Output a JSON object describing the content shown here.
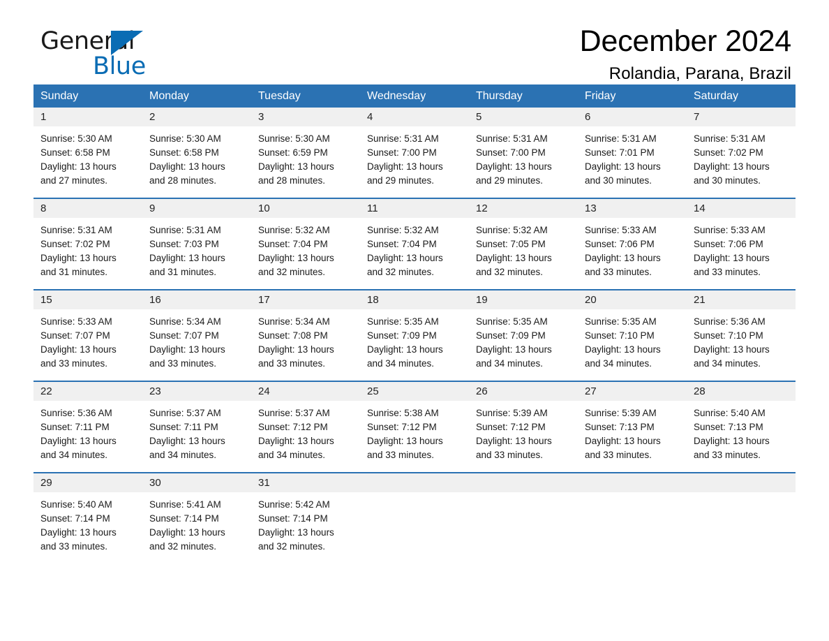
{
  "brand": {
    "name_part1": "General",
    "name_part2": "Blue",
    "logo_icon": "triangle-icon",
    "accent_color": "#0a6cb4"
  },
  "header": {
    "title": "December 2024",
    "subtitle": "Rolandia, Parana, Brazil"
  },
  "theme": {
    "header_blue": "#2b72b3",
    "daynum_band": "#f0f0f0",
    "text": "#1a1a1a"
  },
  "weekdays": [
    "Sunday",
    "Monday",
    "Tuesday",
    "Wednesday",
    "Thursday",
    "Friday",
    "Saturday"
  ],
  "weeks": [
    {
      "days": [
        {
          "date": "1",
          "lines": [
            "Sunrise: 5:30 AM",
            "Sunset: 6:58 PM",
            "Daylight: 13 hours",
            "and 27 minutes."
          ]
        },
        {
          "date": "2",
          "lines": [
            "Sunrise: 5:30 AM",
            "Sunset: 6:58 PM",
            "Daylight: 13 hours",
            "and 28 minutes."
          ]
        },
        {
          "date": "3",
          "lines": [
            "Sunrise: 5:30 AM",
            "Sunset: 6:59 PM",
            "Daylight: 13 hours",
            "and 28 minutes."
          ]
        },
        {
          "date": "4",
          "lines": [
            "Sunrise: 5:31 AM",
            "Sunset: 7:00 PM",
            "Daylight: 13 hours",
            "and 29 minutes."
          ]
        },
        {
          "date": "5",
          "lines": [
            "Sunrise: 5:31 AM",
            "Sunset: 7:00 PM",
            "Daylight: 13 hours",
            "and 29 minutes."
          ]
        },
        {
          "date": "6",
          "lines": [
            "Sunrise: 5:31 AM",
            "Sunset: 7:01 PM",
            "Daylight: 13 hours",
            "and 30 minutes."
          ]
        },
        {
          "date": "7",
          "lines": [
            "Sunrise: 5:31 AM",
            "Sunset: 7:02 PM",
            "Daylight: 13 hours",
            "and 30 minutes."
          ]
        }
      ]
    },
    {
      "days": [
        {
          "date": "8",
          "lines": [
            "Sunrise: 5:31 AM",
            "Sunset: 7:02 PM",
            "Daylight: 13 hours",
            "and 31 minutes."
          ]
        },
        {
          "date": "9",
          "lines": [
            "Sunrise: 5:31 AM",
            "Sunset: 7:03 PM",
            "Daylight: 13 hours",
            "and 31 minutes."
          ]
        },
        {
          "date": "10",
          "lines": [
            "Sunrise: 5:32 AM",
            "Sunset: 7:04 PM",
            "Daylight: 13 hours",
            "and 32 minutes."
          ]
        },
        {
          "date": "11",
          "lines": [
            "Sunrise: 5:32 AM",
            "Sunset: 7:04 PM",
            "Daylight: 13 hours",
            "and 32 minutes."
          ]
        },
        {
          "date": "12",
          "lines": [
            "Sunrise: 5:32 AM",
            "Sunset: 7:05 PM",
            "Daylight: 13 hours",
            "and 32 minutes."
          ]
        },
        {
          "date": "13",
          "lines": [
            "Sunrise: 5:33 AM",
            "Sunset: 7:06 PM",
            "Daylight: 13 hours",
            "and 33 minutes."
          ]
        },
        {
          "date": "14",
          "lines": [
            "Sunrise: 5:33 AM",
            "Sunset: 7:06 PM",
            "Daylight: 13 hours",
            "and 33 minutes."
          ]
        }
      ]
    },
    {
      "days": [
        {
          "date": "15",
          "lines": [
            "Sunrise: 5:33 AM",
            "Sunset: 7:07 PM",
            "Daylight: 13 hours",
            "and 33 minutes."
          ]
        },
        {
          "date": "16",
          "lines": [
            "Sunrise: 5:34 AM",
            "Sunset: 7:07 PM",
            "Daylight: 13 hours",
            "and 33 minutes."
          ]
        },
        {
          "date": "17",
          "lines": [
            "Sunrise: 5:34 AM",
            "Sunset: 7:08 PM",
            "Daylight: 13 hours",
            "and 33 minutes."
          ]
        },
        {
          "date": "18",
          "lines": [
            "Sunrise: 5:35 AM",
            "Sunset: 7:09 PM",
            "Daylight: 13 hours",
            "and 34 minutes."
          ]
        },
        {
          "date": "19",
          "lines": [
            "Sunrise: 5:35 AM",
            "Sunset: 7:09 PM",
            "Daylight: 13 hours",
            "and 34 minutes."
          ]
        },
        {
          "date": "20",
          "lines": [
            "Sunrise: 5:35 AM",
            "Sunset: 7:10 PM",
            "Daylight: 13 hours",
            "and 34 minutes."
          ]
        },
        {
          "date": "21",
          "lines": [
            "Sunrise: 5:36 AM",
            "Sunset: 7:10 PM",
            "Daylight: 13 hours",
            "and 34 minutes."
          ]
        }
      ]
    },
    {
      "days": [
        {
          "date": "22",
          "lines": [
            "Sunrise: 5:36 AM",
            "Sunset: 7:11 PM",
            "Daylight: 13 hours",
            "and 34 minutes."
          ]
        },
        {
          "date": "23",
          "lines": [
            "Sunrise: 5:37 AM",
            "Sunset: 7:11 PM",
            "Daylight: 13 hours",
            "and 34 minutes."
          ]
        },
        {
          "date": "24",
          "lines": [
            "Sunrise: 5:37 AM",
            "Sunset: 7:12 PM",
            "Daylight: 13 hours",
            "and 34 minutes."
          ]
        },
        {
          "date": "25",
          "lines": [
            "Sunrise: 5:38 AM",
            "Sunset: 7:12 PM",
            "Daylight: 13 hours",
            "and 33 minutes."
          ]
        },
        {
          "date": "26",
          "lines": [
            "Sunrise: 5:39 AM",
            "Sunset: 7:12 PM",
            "Daylight: 13 hours",
            "and 33 minutes."
          ]
        },
        {
          "date": "27",
          "lines": [
            "Sunrise: 5:39 AM",
            "Sunset: 7:13 PM",
            "Daylight: 13 hours",
            "and 33 minutes."
          ]
        },
        {
          "date": "28",
          "lines": [
            "Sunrise: 5:40 AM",
            "Sunset: 7:13 PM",
            "Daylight: 13 hours",
            "and 33 minutes."
          ]
        }
      ]
    },
    {
      "days": [
        {
          "date": "29",
          "lines": [
            "Sunrise: 5:40 AM",
            "Sunset: 7:14 PM",
            "Daylight: 13 hours",
            "and 33 minutes."
          ]
        },
        {
          "date": "30",
          "lines": [
            "Sunrise: 5:41 AM",
            "Sunset: 7:14 PM",
            "Daylight: 13 hours",
            "and 32 minutes."
          ]
        },
        {
          "date": "31",
          "lines": [
            "Sunrise: 5:42 AM",
            "Sunset: 7:14 PM",
            "Daylight: 13 hours",
            "and 32 minutes."
          ]
        },
        {
          "date": "",
          "lines": []
        },
        {
          "date": "",
          "lines": []
        },
        {
          "date": "",
          "lines": []
        },
        {
          "date": "",
          "lines": []
        }
      ]
    }
  ]
}
